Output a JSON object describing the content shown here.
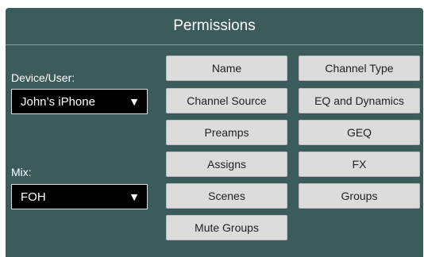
{
  "header": {
    "title": "Permissions"
  },
  "device": {
    "label": "Device/User:",
    "value": "John’s iPhone",
    "caret": "▼"
  },
  "mix": {
    "label": "Mix:",
    "value": "FOH",
    "caret": "▼"
  },
  "buttons": {
    "name": "Name",
    "channel_type": "Channel Type",
    "channel_source": "Channel Source",
    "eq_dynamics": "EQ and Dynamics",
    "preamps": "Preamps",
    "geq": "GEQ",
    "assigns": "Assigns",
    "fx": "FX",
    "scenes": "Scenes",
    "groups": "Groups",
    "mute_groups": "Mute Groups"
  },
  "colors": {
    "panel": "#3c5c5c",
    "button": "#dcdcdc",
    "select": "#000000"
  }
}
